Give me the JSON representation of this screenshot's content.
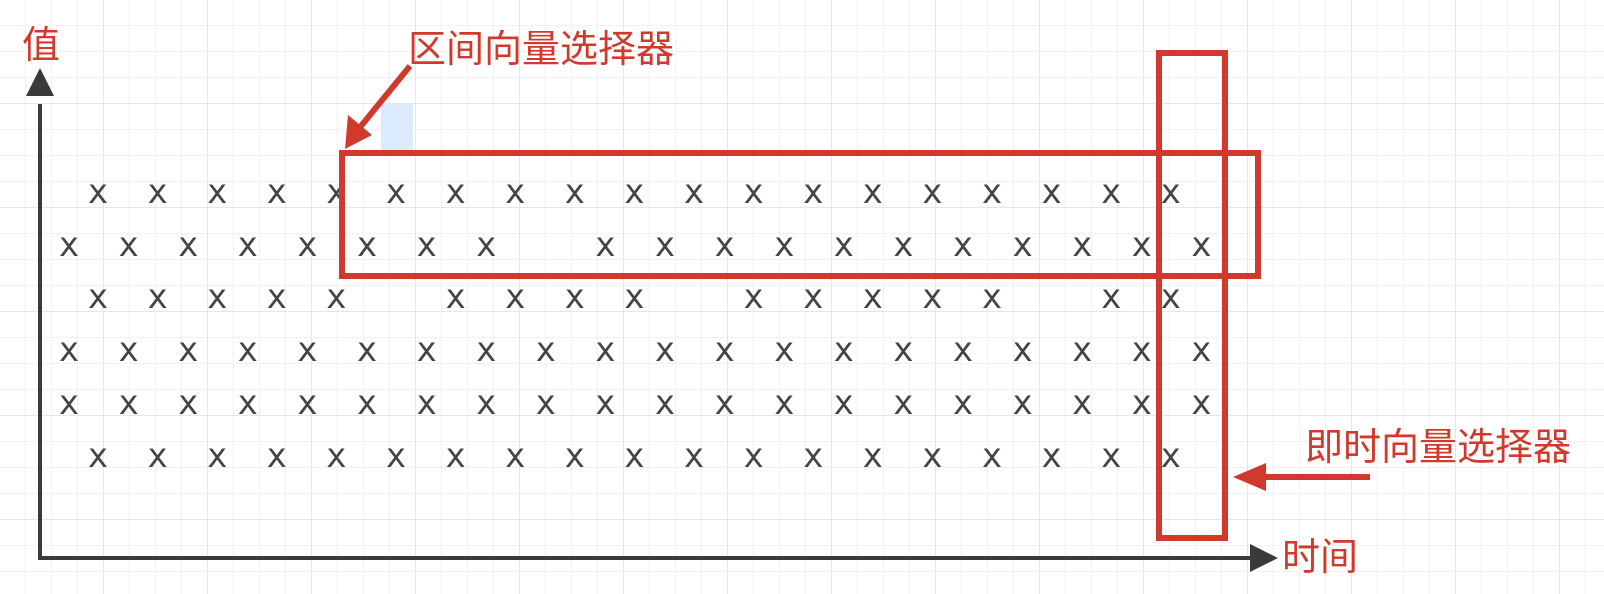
{
  "labels": {
    "y_axis": "值",
    "x_axis": "时间",
    "range_selector": "区间向量选择器",
    "instant_selector": "即时向量选择器"
  },
  "sample_marker": "x",
  "colors": {
    "accent": "#d0392b",
    "axis": "#3a3a3a",
    "marker": "#444444",
    "grid": "#e6e6e6",
    "highlight": "#dceaff"
  },
  "rows": [
    {
      "offset": true,
      "present": [
        1,
        1,
        1,
        1,
        1,
        1,
        1,
        1,
        1,
        1,
        1,
        1,
        1,
        1,
        1,
        1,
        1,
        1,
        1
      ]
    },
    {
      "offset": false,
      "present": [
        1,
        1,
        1,
        1,
        1,
        1,
        1,
        1,
        0,
        1,
        1,
        1,
        1,
        1,
        1,
        1,
        1,
        1,
        1,
        1
      ]
    },
    {
      "offset": true,
      "present": [
        1,
        1,
        1,
        1,
        1,
        0,
        1,
        1,
        1,
        1,
        0,
        1,
        1,
        1,
        1,
        1,
        0,
        1,
        1
      ]
    },
    {
      "offset": false,
      "present": [
        1,
        1,
        1,
        1,
        1,
        1,
        1,
        1,
        1,
        1,
        1,
        1,
        1,
        1,
        1,
        1,
        1,
        1,
        1,
        1
      ]
    },
    {
      "offset": false,
      "present": [
        1,
        1,
        1,
        1,
        1,
        1,
        1,
        1,
        1,
        1,
        1,
        1,
        1,
        1,
        1,
        1,
        1,
        1,
        1,
        1
      ]
    },
    {
      "offset": true,
      "present": [
        1,
        1,
        1,
        1,
        1,
        1,
        1,
        1,
        1,
        1,
        1,
        1,
        1,
        1,
        1,
        1,
        1,
        1,
        1
      ]
    }
  ]
}
